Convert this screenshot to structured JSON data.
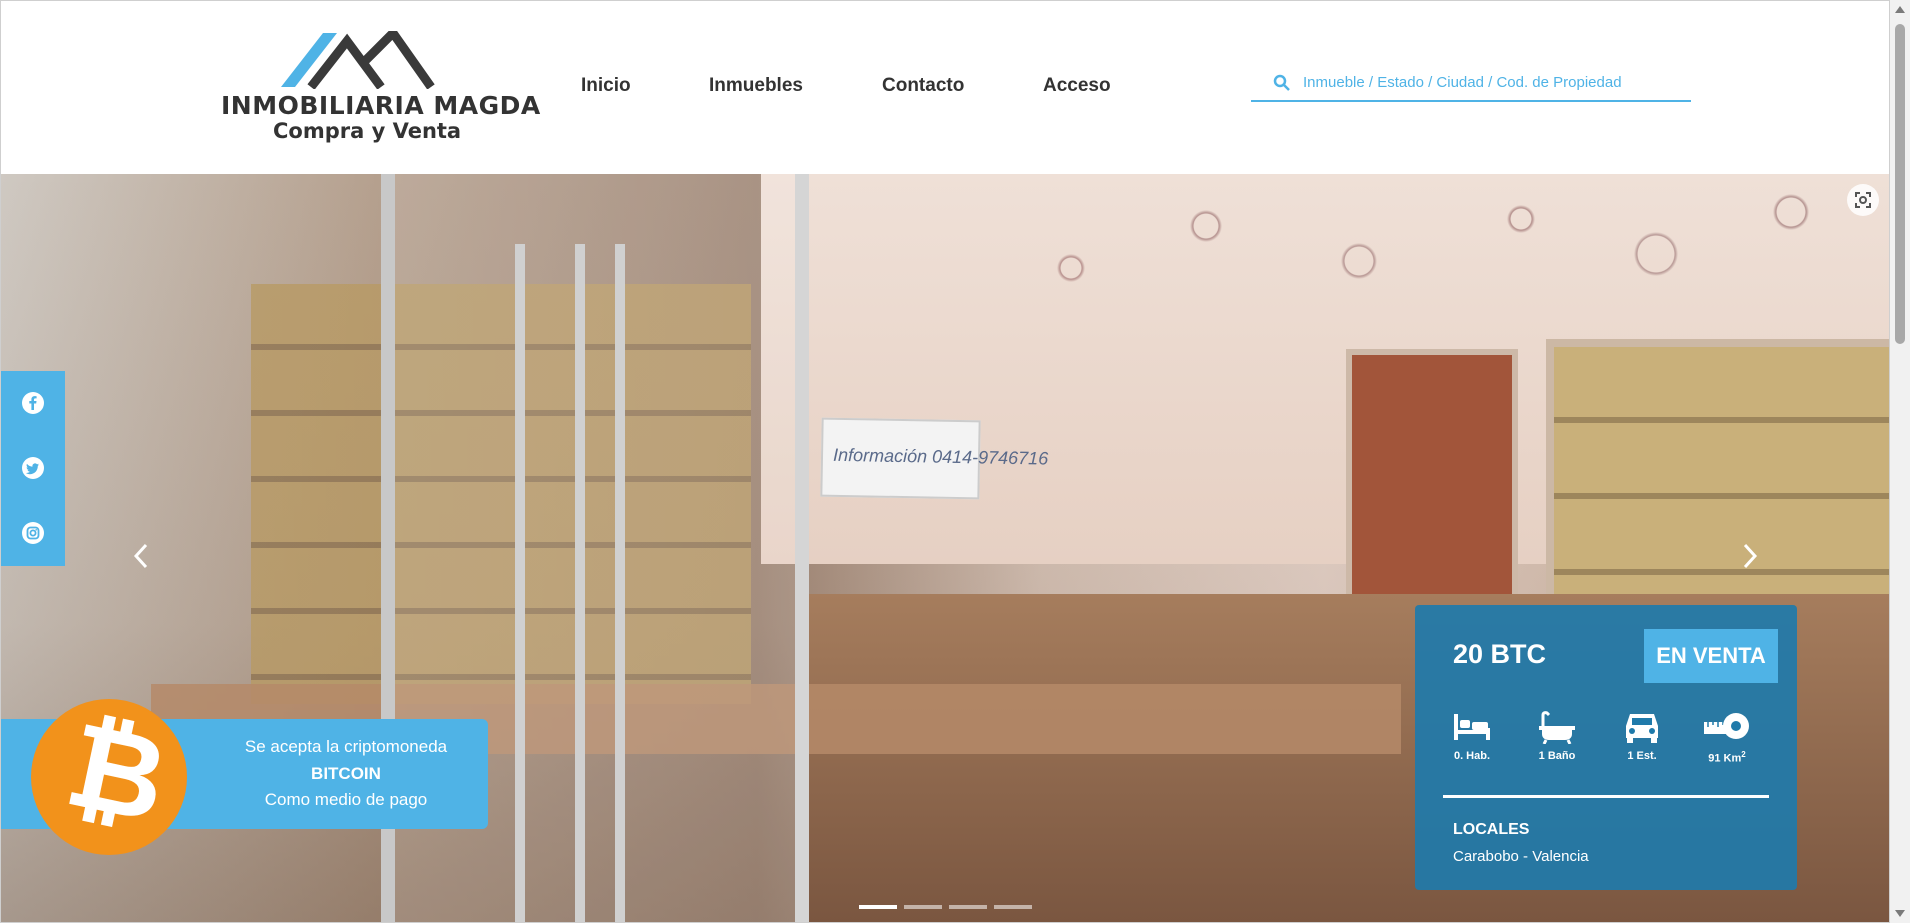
{
  "brand": {
    "name": "INMOBILIARIA MAGDA",
    "tagline": "Compra y Venta",
    "colors": {
      "roof_blue": "#4fb3e6",
      "roof_dark": "#3a3a3a"
    }
  },
  "nav": {
    "items": [
      {
        "label": "Inicio"
      },
      {
        "label": "Inmuebles"
      },
      {
        "label": "Contacto"
      },
      {
        "label": "Acceso"
      }
    ]
  },
  "search": {
    "icon": "search-icon",
    "placeholder": "Inmueble  /  Estado  /  Ciudad  /  Cod. de Propiedad"
  },
  "social": {
    "items": [
      {
        "icon": "facebook-icon"
      },
      {
        "icon": "twitter-icon"
      },
      {
        "icon": "instagram-icon"
      }
    ]
  },
  "slider": {
    "prev_icon": "chevron-left-icon",
    "next_icon": "chevron-right-icon",
    "zoom_icon": "fullscreen-icon",
    "sign_text": "Información 0414-9746716",
    "slide_count": 4,
    "active_slide": 1
  },
  "bitcoin_banner": {
    "symbol": "₿",
    "line1": "Se acepta la criptomoneda",
    "line2": "BITCOIN",
    "line3": "Como medio de pago",
    "colors": {
      "banner": "#4fb3e6",
      "coin": "#f2921b"
    }
  },
  "property": {
    "price": "20 BTC",
    "status": "EN VENTA",
    "features": [
      {
        "icon": "bed-icon",
        "label": "0. Hab."
      },
      {
        "icon": "bathtub-icon",
        "label": "1 Baño"
      },
      {
        "icon": "car-icon",
        "label": "1 Est."
      },
      {
        "icon": "tape-measure-icon",
        "label": "91 Km",
        "sup": "2"
      }
    ],
    "type": "LOCALES",
    "location": "Carabobo - Valencia",
    "colors": {
      "card": "#1f7aaa",
      "status_bg": "#4fb3e6"
    }
  }
}
